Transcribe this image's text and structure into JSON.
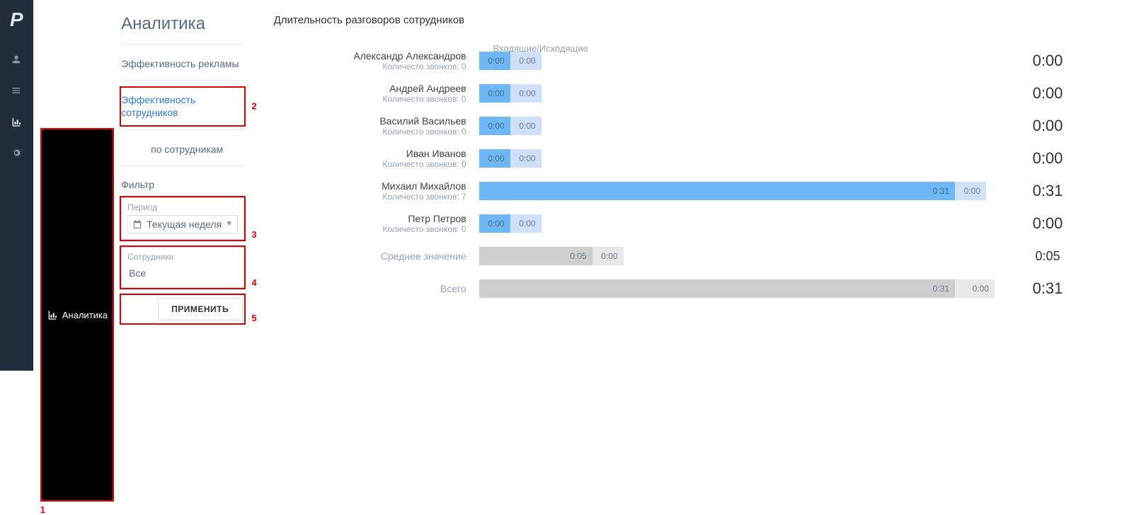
{
  "tooltip": {
    "label": "Аналитика"
  },
  "sidebar": {
    "title": "Аналитика",
    "links": {
      "ads": "Эффективность рекламы",
      "employees": "Эффективность сотрудников",
      "by_employee": "по сотрудникам"
    },
    "filter": {
      "header": "Фильтр",
      "period_label": "Период",
      "period_value": "Текущая неделя",
      "employees_label": "Сотрудники",
      "employees_value": "Все",
      "apply": "ПРИМЕНИТЬ"
    }
  },
  "annotations": {
    "n1": "1",
    "n2": "2",
    "n3": "3",
    "n4": "4",
    "n5": "5"
  },
  "main": {
    "title": "Длительность разговоров сотрудников",
    "legend": "Входящие/Исходящие",
    "calls_prefix": "Количесто звонков: "
  },
  "chart_data": {
    "type": "bar",
    "orientation": "horizontal",
    "title": "Длительность разговоров сотрудников",
    "xlabel": "",
    "ylabel": "",
    "categories": [
      "Александр Александров",
      "Андрей Андреев",
      "Василий Васильев",
      "Иван Иванов",
      "Михаил Михайлов",
      "Петр Петров"
    ],
    "call_counts": [
      0,
      0,
      0,
      0,
      7,
      0
    ],
    "series": [
      {
        "name": "Входящие",
        "values": [
          "0:00",
          "0:00",
          "0:00",
          "0:00",
          "0:31",
          "0:00"
        ]
      },
      {
        "name": "Исходящие",
        "values": [
          "0:00",
          "0:00",
          "0:00",
          "0:00",
          "0:00",
          "0:00"
        ]
      }
    ],
    "row_totals": [
      "0:00",
      "0:00",
      "0:00",
      "0:00",
      "0:31",
      "0:00"
    ],
    "summary": {
      "average_label": "Среднее значение",
      "average": {
        "in": "0:05",
        "out": "0:00",
        "total": "0:05"
      },
      "total_label": "Всего",
      "total": {
        "in": "0:31",
        "out": "0:00",
        "total": "0:31"
      }
    },
    "max_seconds": 31
  }
}
